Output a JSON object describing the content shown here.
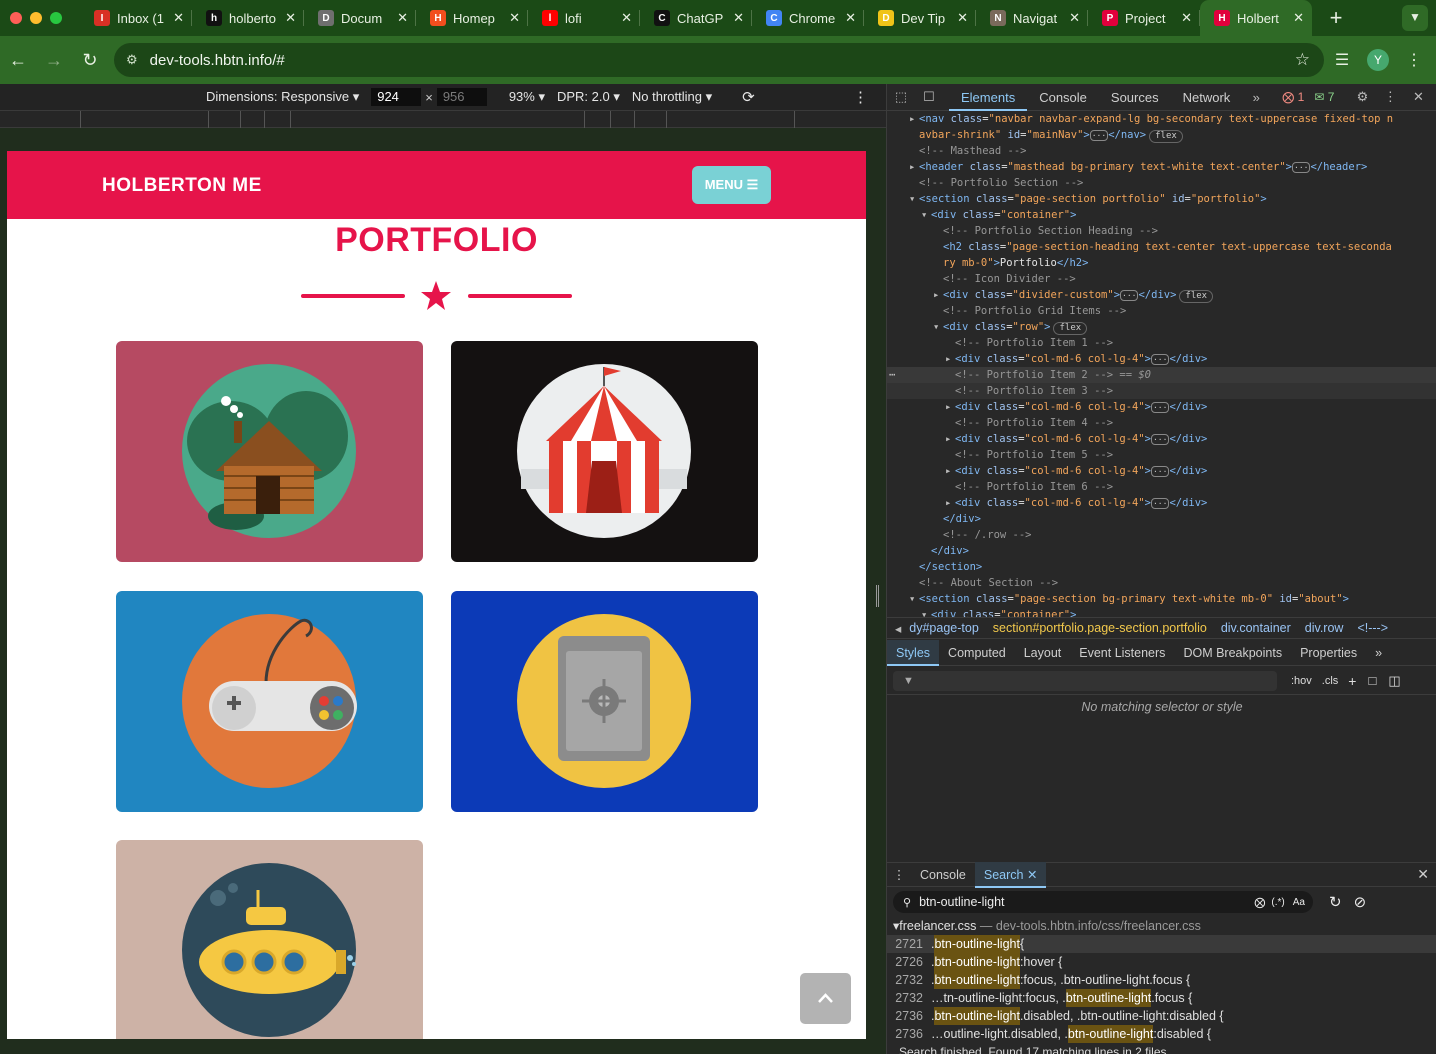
{
  "browser": {
    "tabs": [
      {
        "title": "Inbox (1",
        "icon": "gmail-icon",
        "color": "#d93025"
      },
      {
        "title": "holberto",
        "icon": "github-icon",
        "color": "#111111"
      },
      {
        "title": "Docum",
        "icon": "globe-icon",
        "color": "#6f6f6f"
      },
      {
        "title": "Homep",
        "icon": "figma-icon",
        "color": "#f24e1e"
      },
      {
        "title": "lofi",
        "icon": "youtube-icon",
        "color": "#ff0000"
      },
      {
        "title": "ChatGP",
        "icon": "openai-icon",
        "color": "#111111"
      },
      {
        "title": "Chrome",
        "icon": "chrome-icon",
        "color": "#4285f4"
      },
      {
        "title": "Dev Tip",
        "icon": "u-icon",
        "color": "#f0c419"
      },
      {
        "title": "Navigat",
        "icon": "book-icon",
        "color": "#7a6a5b"
      },
      {
        "title": "Project",
        "icon": "holberton-icon",
        "color": "#e1003c"
      },
      {
        "title": "Holbert",
        "icon": "holberton-icon",
        "color": "#e1003c"
      }
    ],
    "url": "dev-tools.hbtn.info/#",
    "profile_initial": "Y"
  },
  "device_toolbar": {
    "dimensions": "Dimensions: Responsive",
    "width": "924",
    "height": "956",
    "zoom": "93%",
    "dpr": "DPR: 2.0",
    "throttling": "No throttling"
  },
  "site": {
    "brand": "HOLBERTON ME",
    "menu": "MENU",
    "heading": "PORTFOLIO",
    "colors": {
      "primary": "#e6144a",
      "menu_button": "#7ad1d5"
    },
    "portfolio_items": [
      {
        "name": "cabin",
        "bg": "#b64a62",
        "circle": "#4aa98a"
      },
      {
        "name": "circus",
        "bg": "#141111",
        "circle": "#eceeef"
      },
      {
        "name": "game",
        "bg": "#2086c1",
        "circle": "#e1783b"
      },
      {
        "name": "safe",
        "bg": "#0c3ab7",
        "circle": "#f0c343"
      },
      {
        "name": "submarine",
        "bg": "#cdb2a6",
        "circle": "#2e4a5a"
      }
    ]
  },
  "devtools": {
    "tabs": [
      "Elements",
      "Console",
      "Sources",
      "Network"
    ],
    "errors": "1",
    "messages": "7",
    "dom_lines": [
      [
        {
          "t": "tg",
          "v": "<nav "
        },
        {
          "t": "at",
          "v": "class"
        },
        {
          "t": "tx",
          "v": "="
        },
        {
          "t": "av",
          "v": "\"navbar navbar-expand-lg bg-secondary text-uppercase fixed-top n"
        }
      ],
      [
        {
          "t": "av",
          "v": "avbar-shrink\""
        },
        {
          "t": "tx",
          "v": " "
        },
        {
          "t": "at",
          "v": "id"
        },
        {
          "t": "tx",
          "v": "="
        },
        {
          "t": "av",
          "v": "\"mainNav\""
        },
        {
          "t": "tg",
          "v": ">"
        },
        {
          "t": "ell",
          "v": "···"
        },
        {
          "t": "tg",
          "v": "</nav>"
        },
        {
          "t": "pill",
          "v": "flex"
        }
      ],
      [
        {
          "t": "cm",
          "v": "<!-- Masthead -->"
        }
      ],
      [
        {
          "t": "tg",
          "v": "<header "
        },
        {
          "t": "at",
          "v": "class"
        },
        {
          "t": "tx",
          "v": "="
        },
        {
          "t": "av",
          "v": "\"masthead bg-primary text-white text-center\""
        },
        {
          "t": "tg",
          "v": ">"
        },
        {
          "t": "ell",
          "v": "···"
        },
        {
          "t": "tg",
          "v": "</header>"
        }
      ],
      [
        {
          "t": "cm",
          "v": "<!-- Portfolio Section -->"
        }
      ],
      [
        {
          "t": "tg",
          "v": "<section "
        },
        {
          "t": "at",
          "v": "class"
        },
        {
          "t": "tx",
          "v": "="
        },
        {
          "t": "av",
          "v": "\"page-section portfolio\""
        },
        {
          "t": "tx",
          "v": " "
        },
        {
          "t": "at",
          "v": "id"
        },
        {
          "t": "tx",
          "v": "="
        },
        {
          "t": "av",
          "v": "\"portfolio\""
        },
        {
          "t": "tg",
          "v": ">"
        }
      ],
      [
        {
          "t": "tg",
          "v": "<div "
        },
        {
          "t": "at",
          "v": "class"
        },
        {
          "t": "tx",
          "v": "="
        },
        {
          "t": "av",
          "v": "\"container\""
        },
        {
          "t": "tg",
          "v": ">"
        }
      ],
      [
        {
          "t": "cm",
          "v": "<!-- Portfolio Section Heading -->"
        }
      ],
      [
        {
          "t": "tg",
          "v": "<h2 "
        },
        {
          "t": "at",
          "v": "class"
        },
        {
          "t": "tx",
          "v": "="
        },
        {
          "t": "av",
          "v": "\"page-section-heading text-center text-uppercase text-seconda"
        }
      ],
      [
        {
          "t": "av",
          "v": "ry mb-0\""
        },
        {
          "t": "tg",
          "v": ">"
        },
        {
          "t": "tx",
          "v": "Portfolio"
        },
        {
          "t": "tg",
          "v": "</h2>"
        }
      ],
      [
        {
          "t": "cm",
          "v": "<!-- Icon Divider -->"
        }
      ],
      [
        {
          "t": "tg",
          "v": "<div "
        },
        {
          "t": "at",
          "v": "class"
        },
        {
          "t": "tx",
          "v": "="
        },
        {
          "t": "av",
          "v": "\"divider-custom\""
        },
        {
          "t": "tg",
          "v": ">"
        },
        {
          "t": "ell",
          "v": "···"
        },
        {
          "t": "tg",
          "v": "</div>"
        },
        {
          "t": "pill",
          "v": "flex"
        }
      ],
      [
        {
          "t": "cm",
          "v": "<!-- Portfolio Grid Items -->"
        }
      ],
      [
        {
          "t": "tg",
          "v": "<div "
        },
        {
          "t": "at",
          "v": "class"
        },
        {
          "t": "tx",
          "v": "="
        },
        {
          "t": "av",
          "v": "\"row\""
        },
        {
          "t": "tg",
          "v": ">"
        },
        {
          "t": "pill",
          "v": "flex"
        }
      ],
      [
        {
          "t": "cm",
          "v": "<!-- Portfolio Item 1 -->"
        }
      ],
      [
        {
          "t": "tg",
          "v": "<div "
        },
        {
          "t": "at",
          "v": "class"
        },
        {
          "t": "tx",
          "v": "="
        },
        {
          "t": "av",
          "v": "\"col-md-6 col-lg-4\""
        },
        {
          "t": "tg",
          "v": ">"
        },
        {
          "t": "ell",
          "v": "···"
        },
        {
          "t": "tg",
          "v": "</div>"
        }
      ],
      [
        {
          "t": "cm",
          "v": "<!-- Portfolio Item 2 -->"
        },
        {
          "t": "cm",
          "v": " == $0"
        }
      ],
      [
        {
          "t": "cm",
          "v": "<!-- Portfolio Item 3 -->"
        }
      ],
      [
        {
          "t": "tg",
          "v": "<div "
        },
        {
          "t": "at",
          "v": "class"
        },
        {
          "t": "tx",
          "v": "="
        },
        {
          "t": "av",
          "v": "\"col-md-6 col-lg-4\""
        },
        {
          "t": "tg",
          "v": ">"
        },
        {
          "t": "ell",
          "v": "···"
        },
        {
          "t": "tg",
          "v": "</div>"
        }
      ],
      [
        {
          "t": "cm",
          "v": "<!-- Portfolio Item 4 -->"
        }
      ],
      [
        {
          "t": "tg",
          "v": "<div "
        },
        {
          "t": "at",
          "v": "class"
        },
        {
          "t": "tx",
          "v": "="
        },
        {
          "t": "av",
          "v": "\"col-md-6 col-lg-4\""
        },
        {
          "t": "tg",
          "v": ">"
        },
        {
          "t": "ell",
          "v": "···"
        },
        {
          "t": "tg",
          "v": "</div>"
        }
      ],
      [
        {
          "t": "cm",
          "v": "<!-- Portfolio Item 5 -->"
        }
      ],
      [
        {
          "t": "tg",
          "v": "<div "
        },
        {
          "t": "at",
          "v": "class"
        },
        {
          "t": "tx",
          "v": "="
        },
        {
          "t": "av",
          "v": "\"col-md-6 col-lg-4\""
        },
        {
          "t": "tg",
          "v": ">"
        },
        {
          "t": "ell",
          "v": "···"
        },
        {
          "t": "tg",
          "v": "</div>"
        }
      ],
      [
        {
          "t": "cm",
          "v": "<!-- Portfolio Item 6 -->"
        }
      ],
      [
        {
          "t": "tg",
          "v": "<div "
        },
        {
          "t": "at",
          "v": "class"
        },
        {
          "t": "tx",
          "v": "="
        },
        {
          "t": "av",
          "v": "\"col-md-6 col-lg-4\""
        },
        {
          "t": "tg",
          "v": ">"
        },
        {
          "t": "ell",
          "v": "···"
        },
        {
          "t": "tg",
          "v": "</div>"
        }
      ],
      [
        {
          "t": "tg",
          "v": "</div>"
        }
      ],
      [
        {
          "t": "cm",
          "v": "<!-- /.row -->"
        }
      ],
      [
        {
          "t": "tg",
          "v": "</div>"
        }
      ],
      [
        {
          "t": "tg",
          "v": "</section>"
        }
      ],
      [
        {
          "t": "cm",
          "v": "<!-- About Section -->"
        }
      ],
      [
        {
          "t": "tg",
          "v": "<section "
        },
        {
          "t": "at",
          "v": "class"
        },
        {
          "t": "tx",
          "v": "="
        },
        {
          "t": "av",
          "v": "\"page-section bg-primary text-white mb-0\""
        },
        {
          "t": "tx",
          "v": " "
        },
        {
          "t": "at",
          "v": "id"
        },
        {
          "t": "tx",
          "v": "="
        },
        {
          "t": "av",
          "v": "\"about\""
        },
        {
          "t": "tg",
          "v": ">"
        }
      ],
      [
        {
          "t": "tg",
          "v": "<div "
        },
        {
          "t": "at",
          "v": "class"
        },
        {
          "t": "tx",
          "v": "="
        },
        {
          "t": "av",
          "v": "\"container\""
        },
        {
          "t": "tg",
          "v": ">"
        }
      ]
    ],
    "breadcrumbs": [
      "dy#page-top",
      "section#portfolio.page-section.portfolio",
      "div.container",
      "div.row",
      "<!--->"
    ],
    "styles_tabs": [
      "Styles",
      "Computed",
      "Layout",
      "Event Listeners",
      "DOM Breakpoints",
      "Properties"
    ],
    "filter_hov": ":hov",
    "filter_cls": ".cls",
    "no_match": "No matching selector or style",
    "drawer_tabs": [
      "Console",
      "Search"
    ],
    "search_query": "btn-outline-light",
    "search_opt_regex": "(.*)",
    "search_opt_case": "Aa",
    "result_file": "freelancer.css",
    "result_path": "dev-tools.hbtn.info/css/freelancer.css",
    "results": [
      {
        "line": "2721",
        "pre": ".",
        "hl": "btn-outline-light",
        "post": " {"
      },
      {
        "line": "2726",
        "pre": ".",
        "hl": "btn-outline-light",
        "post": ":hover {"
      },
      {
        "line": "2732",
        "pre": ".",
        "hl": "btn-outline-light",
        "post": ":focus, .btn-outline-light.focus {"
      },
      {
        "line": "2732",
        "pre": "…tn-outline-light:focus, .",
        "hl": "btn-outline-light",
        "post": ".focus {"
      },
      {
        "line": "2736",
        "pre": ".",
        "hl": "btn-outline-light",
        "post": ".disabled, .btn-outline-light:disabled {"
      },
      {
        "line": "2736",
        "pre": "…outline-light.disabled, .",
        "hl": "btn-outline-light",
        "post": ":disabled {"
      }
    ],
    "search_status": "Search finished.  Found 17 matching lines in 2 files."
  }
}
